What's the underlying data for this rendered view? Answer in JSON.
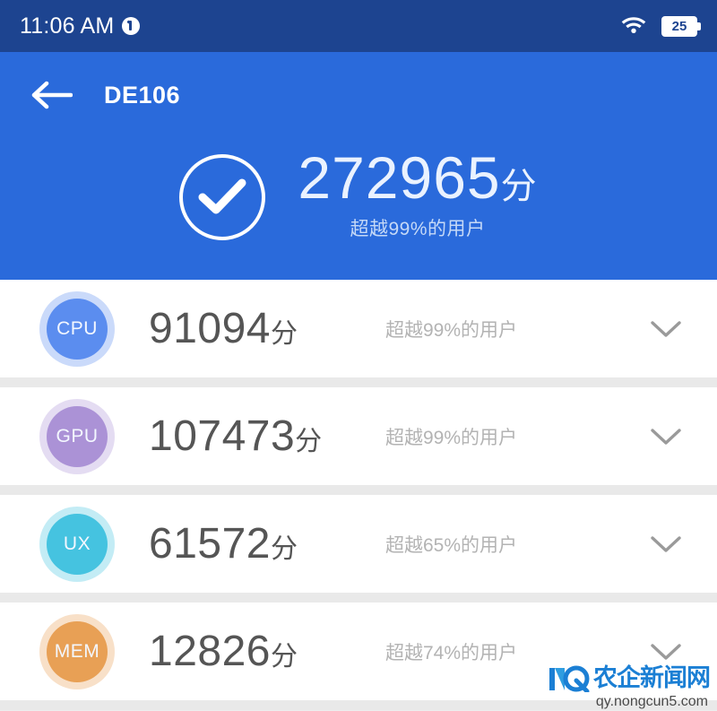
{
  "status_bar": {
    "time": "11:06 AM",
    "notification_icon": "info-badge-icon",
    "wifi_icon": "wifi-icon",
    "battery_level": "25"
  },
  "app_bar": {
    "back_icon": "back-arrow-icon",
    "title": "DE106"
  },
  "summary": {
    "check_icon": "check-circle-icon",
    "total_score": "272965",
    "score_unit": "分",
    "subtitle": "超越99%的用户"
  },
  "results": [
    {
      "badge": "CPU",
      "badge_color": "#5b8def",
      "score": "91094",
      "unit": "分",
      "subtitle": "超越99%的用户",
      "expand_icon": "chevron-down-icon"
    },
    {
      "badge": "GPU",
      "badge_color": "#ab92d6",
      "score": "107473",
      "unit": "分",
      "subtitle": "超越99%的用户",
      "expand_icon": "chevron-down-icon"
    },
    {
      "badge": "UX",
      "badge_color": "#45c3e0",
      "score": "61572",
      "unit": "分",
      "subtitle": "超越65%的用户",
      "expand_icon": "chevron-down-icon"
    },
    {
      "badge": "MEM",
      "badge_color": "#e8a055",
      "score": "12826",
      "unit": "分",
      "subtitle": "超越74%的用户",
      "expand_icon": "chevron-down-icon"
    }
  ],
  "watermark": {
    "logo_text": "农企新闻网",
    "url": "qy.nongcun5.com"
  },
  "colors": {
    "status_bar": "#1d4490",
    "hero": "#2a6adb",
    "card": "#ffffff",
    "divider": "#e9e9e9",
    "score_text": "#555555",
    "subtitle_text": "#b3b3b3"
  }
}
